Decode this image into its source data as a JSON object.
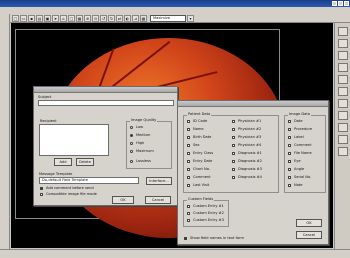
{
  "toolbar": {
    "zoom_value": "Maximize"
  },
  "send_dialog": {
    "subject_label": "Subject",
    "recipient_label": "Recipient",
    "add_label": "Add",
    "delete_label": "Delete",
    "image_quality_label": "Image Quality",
    "quality_options": [
      {
        "label": "Low",
        "selected": false
      },
      {
        "label": "Medium",
        "selected": true
      },
      {
        "label": "High",
        "selected": false
      },
      {
        "label": "Maximum",
        "selected": false
      },
      {
        "label": "Lossless",
        "selected": false
      }
    ],
    "message_template_label": "Message Template",
    "template_value": "Do-default Field Template",
    "interface_label": "Interface...",
    "add_comment_label": "Add comment before send",
    "compatible_label": "Compatible image file mode",
    "ok_label": "OK",
    "cancel_label": "Cancel"
  },
  "fields_dialog": {
    "patient_data_label": "Patient Data",
    "patient_col1": [
      "ID Code",
      "Name",
      "Birth Date",
      "Sex",
      "Entry Class",
      "Entry Date",
      "Chart No.",
      "Comment",
      "Last Visit"
    ],
    "patient_col2": [
      "Physician #1",
      "Physician #2",
      "Physician #3",
      "Physician #4",
      "Diagnosis #1",
      "Diagnosis #2",
      "Diagnosis #3",
      "Diagnosis #4"
    ],
    "image_data_label": "Image Data",
    "image_col": [
      "Date",
      "Procedure",
      "Label",
      "Comment",
      "File Name",
      "Eye",
      "Angle",
      "Serial No.",
      "Note"
    ],
    "custom_fields_label": "Custom Fields",
    "custom_fields": [
      "Custom Entry #1",
      "Custom Entry #2",
      "Custom Entry #3"
    ],
    "show_names_label": "Show field names in text form",
    "ok_label": "OK",
    "cancel_label": "Cancel"
  }
}
